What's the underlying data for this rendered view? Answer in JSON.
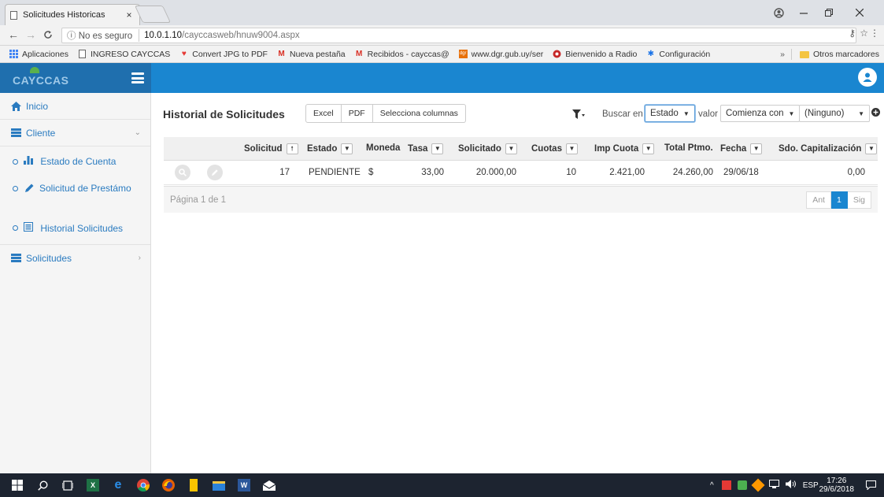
{
  "browser": {
    "tab_title": "Solicitudes Historicas",
    "tab_close": "×",
    "security_label": "No es seguro",
    "url_host": "10.0.1.10",
    "url_path": "/cayccasweb/hnuw9004.aspx",
    "bookmarks": [
      {
        "label": "Aplicaciones",
        "icon": "apps-grid-icon",
        "color": "#4285f4"
      },
      {
        "label": "INGRESO CAYCCAS",
        "icon": "page-icon",
        "color": "#666666"
      },
      {
        "label": "Convert JPG to PDF",
        "icon": "heart-icon",
        "color": "#e53935"
      },
      {
        "label": "Nueva pestaña",
        "icon": "gmail-icon",
        "color": "#d93025"
      },
      {
        "label": "Recibidos - cayccas@",
        "icon": "gmail-icon",
        "color": "#d93025"
      },
      {
        "label": "www.dgr.gub.uy/ser",
        "icon": "dgr-icon",
        "color": "#e8710a"
      },
      {
        "label": "Bienvenido a Radio",
        "icon": "radio-icon",
        "color": "#c62828"
      },
      {
        "label": "Configuración",
        "icon": "gear-icon",
        "color": "#1a73e8"
      }
    ],
    "bookmarks_overflow": "»",
    "other_bookmarks": "Otros marcadores"
  },
  "app": {
    "brand": "CAYCCAS",
    "accent": "#1a86d0",
    "brand_bg": "#1f6fae"
  },
  "sidebar": {
    "inicio": "Inicio",
    "cliente": "Cliente",
    "sub_items": [
      {
        "label": "Estado de Cuenta"
      },
      {
        "label": "Solicitud de Prestámo"
      },
      {
        "label": "Historial Solicitudes"
      }
    ],
    "solicitudes": "Solicitudes"
  },
  "main": {
    "title": "Historial de Solicitudes",
    "buttons": {
      "excel": "Excel",
      "pdf": "PDF",
      "columns": "Selecciona columnas"
    },
    "filter": {
      "search_in_label": "Buscar en",
      "search_in_value": "Estado",
      "value_label": "valor",
      "operator_value": "Comienza con",
      "value_value": "(Ninguno)"
    },
    "columns": {
      "solicitud": "Solicitud",
      "estado": "Estado",
      "moneda": "Moneda",
      "tasa": "Tasa",
      "solicitado": "Solicitado",
      "cuotas": "Cuotas",
      "imp_cuota": "Imp Cuota",
      "total_ptmo": "Total Ptmo.",
      "fecha": "Fecha",
      "sdo_cap": "Sdo. Capitalización"
    },
    "rows": [
      {
        "solicitud": "17",
        "estado": "PENDIENTE",
        "moneda": "$",
        "tasa": "33,00",
        "solicitado": "20.000,00",
        "cuotas": "10",
        "imp_cuota": "2.421,00",
        "total_ptmo": "24.260,00",
        "fecha": "29/06/18",
        "sdo_cap": "0,00"
      }
    ],
    "page_info": "Página 1 de 1",
    "pager": {
      "prev": "Ant",
      "current": "1",
      "next": "Sig"
    }
  },
  "taskbar": {
    "language": "ESP",
    "time": "17:26",
    "date": "29/6/2018"
  }
}
